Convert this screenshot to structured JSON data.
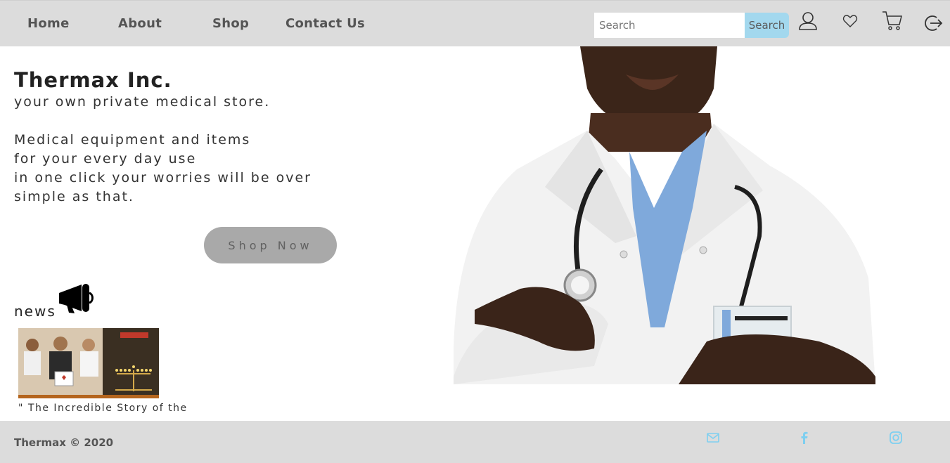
{
  "nav": {
    "home": "Home",
    "about": "About",
    "shop": "Shop",
    "contact": "Contact Us"
  },
  "search": {
    "placeholder": "Search",
    "button_label": "Search"
  },
  "header_icons": [
    "user-icon",
    "heart-icon",
    "cart-icon",
    "logout-icon"
  ],
  "hero": {
    "title": "Thermax Inc.",
    "tagline": "your own private medical store.",
    "description": [
      "Medical equipment and items",
      "for your every day use",
      "in one click your worries will be over",
      "simple as that."
    ],
    "cta_label": "Shop Now"
  },
  "news": {
    "label": "news",
    "icon": "megaphone-icon",
    "items": [
      {
        "caption": "\" The Incredible Story of the"
      }
    ]
  },
  "footer": {
    "copyright": "Thermax © 2020",
    "social_icons": [
      "mail-icon",
      "facebook-icon",
      "instagram-icon"
    ],
    "icon_color": "#7ecff0"
  },
  "colors": {
    "bar_bg": "#dcdcdc",
    "search_button": "#a3d8ee",
    "cta_button": "#a9a9a9"
  }
}
